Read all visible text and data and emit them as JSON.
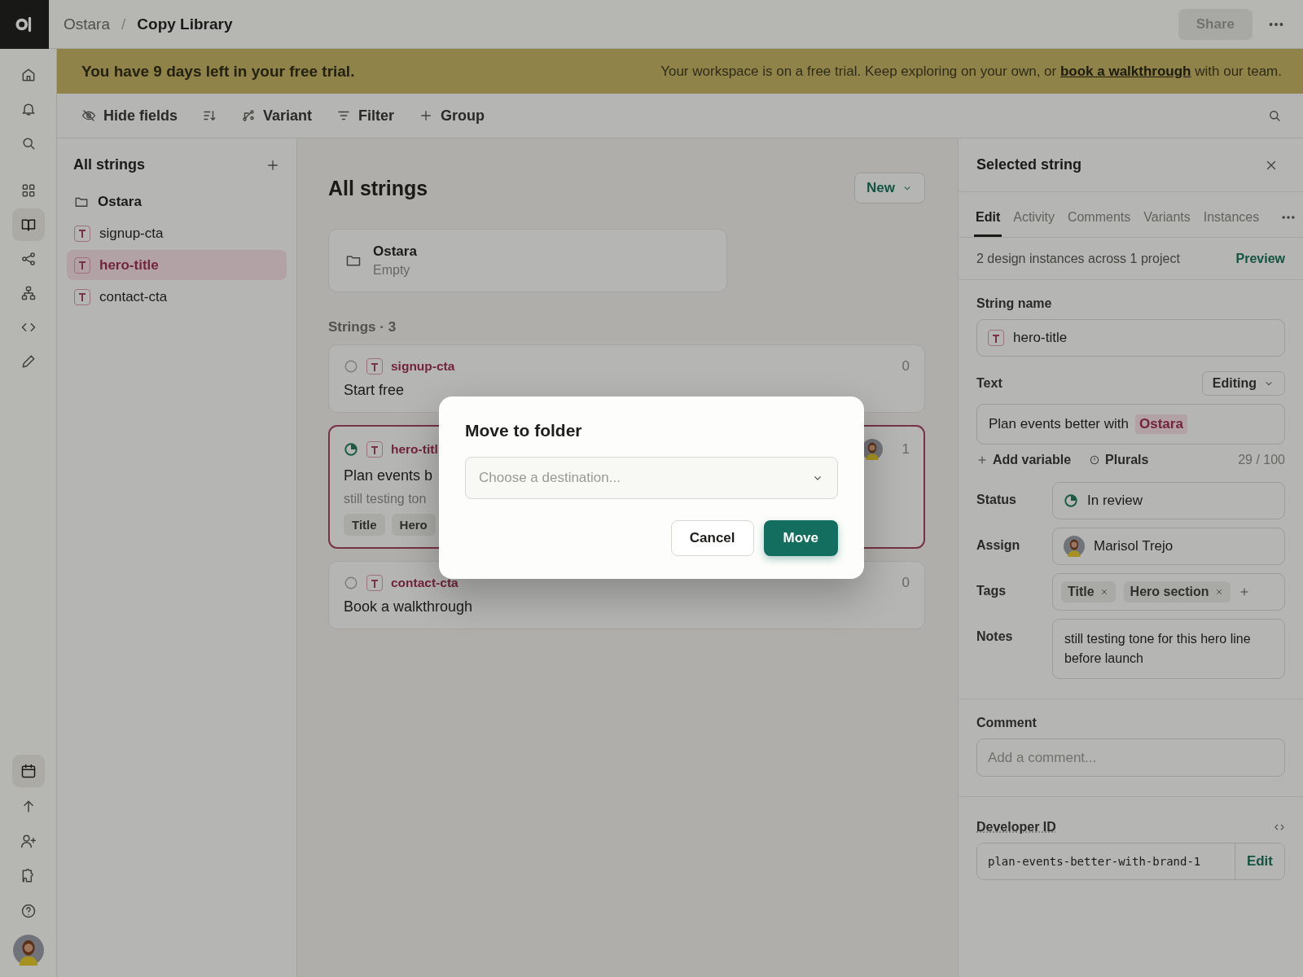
{
  "topbar": {
    "breadcrumb": [
      "Ostara",
      "Copy Library"
    ],
    "separator": "/",
    "share": "Share"
  },
  "rail": {
    "top": [
      {
        "selected": false
      },
      {
        "selected": false
      },
      {
        "selected": false
      }
    ],
    "middle": [
      {
        "selected": false
      },
      {
        "selected": true
      },
      {
        "selected": false
      },
      {
        "selected": false
      },
      {
        "selected": false
      },
      {
        "selected": false
      }
    ],
    "bottom": [
      {
        "selected": true
      },
      {
        "selected": false
      },
      {
        "selected": false
      },
      {
        "selected": false
      },
      {
        "selected": false
      }
    ]
  },
  "banner": {
    "message": "You have 9 days left in your free trial.",
    "note_before": "Your workspace is on a free trial. Keep exploring on your own, or",
    "link": "book a walkthrough",
    "note_after": "with our team."
  },
  "toolbar": {
    "buttons": [
      {
        "kind": "hide",
        "label": "Hide fields"
      },
      {
        "kind": "sort"
      },
      {
        "kind": "variant",
        "label": "Variant"
      },
      {
        "kind": "filter",
        "label": "Filter"
      },
      {
        "kind": "group",
        "label": "Group"
      }
    ]
  },
  "sidebar": {
    "title": "All strings",
    "items": [
      {
        "kind": "folder",
        "label": "Ostara",
        "selected": false
      },
      {
        "kind": "string",
        "label": "signup-cta",
        "selected": false
      },
      {
        "kind": "string",
        "label": "hero-title",
        "selected": true
      },
      {
        "kind": "string",
        "label": "contact-cta",
        "selected": false
      }
    ]
  },
  "main": {
    "title": "All strings",
    "new_button": "New",
    "folder": {
      "name": "Ostara",
      "note": "Empty"
    },
    "section": "Strings · 3",
    "strings": [
      {
        "name": "signup-cta",
        "text": "Start free",
        "count": "0",
        "in_review": false,
        "selected": false
      },
      {
        "name": "hero-titl",
        "text": "Plan events b",
        "note": "still testing ton",
        "tags": [
          "Title",
          "Hero"
        ],
        "count": "1",
        "in_review": true,
        "assigned": true,
        "selected": true
      },
      {
        "name": "contact-cta",
        "text": "Book a walkthrough",
        "count": "0",
        "in_review": false,
        "selected": false
      }
    ]
  },
  "modal": {
    "title": "Move to folder",
    "placeholder": "Choose a destination...",
    "cancel": "Cancel",
    "confirm": "Move"
  },
  "details": {
    "title": "Selected string",
    "tabs": [
      {
        "label": "Edit",
        "selected": true
      },
      {
        "label": "Activity",
        "selected": false
      },
      {
        "label": "Comments",
        "selected": false
      },
      {
        "label": "Variants",
        "selected": false
      },
      {
        "label": "Instances",
        "selected": false
      }
    ],
    "summary": "2 design instances across 1 project",
    "preview": "Preview",
    "name_label": "String name",
    "name_value": "hero-title",
    "text_label": "Text",
    "mode": "Editing",
    "text_value": "Plan events better with",
    "variable": "Ostara",
    "add_variable": "Add variable",
    "plurals": "Plurals",
    "char_count": "29 / 100",
    "status_label": "Status",
    "status_value": "In review",
    "in_review": true,
    "assign_label": "Assign",
    "assignee": "Marisol Trejo",
    "tags_label": "Tags",
    "tags": [
      "Title",
      "Hero section"
    ],
    "notes_label": "Notes",
    "notes": "still testing tone for this hero line before launch",
    "comment_label": "Comment",
    "comment_placeholder": "Add a comment...",
    "dev_label": "Developer ID",
    "dev_id": "plan-events-better-with-brand-1",
    "dev_edit": "Edit"
  }
}
